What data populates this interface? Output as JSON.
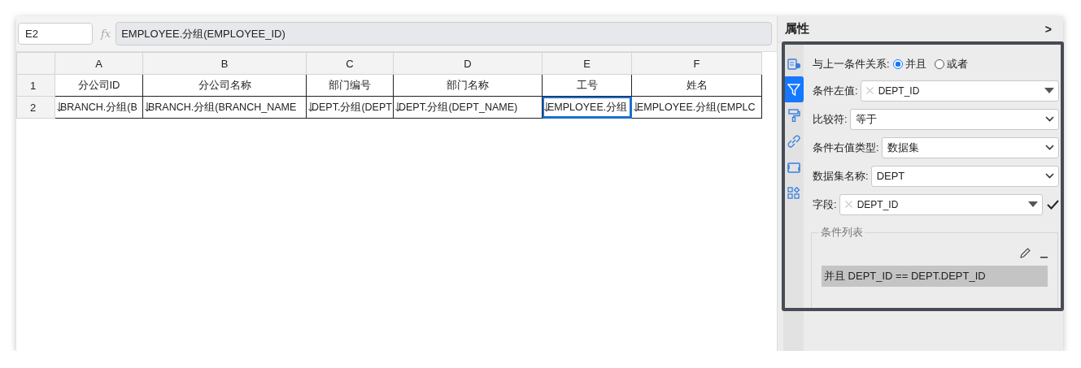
{
  "name_box": "E2",
  "function_label": "fx",
  "formula": "EMPLOYEE.分组(EMPLOYEE_ID)",
  "columns": [
    "A",
    "B",
    "C",
    "D",
    "E",
    "F"
  ],
  "rows": [
    {
      "number": "1",
      "cells": [
        {
          "text": "分公司ID",
          "kind": "header",
          "selected": false
        },
        {
          "text": "分公司名称",
          "kind": "header",
          "selected": false
        },
        {
          "text": "部门编号",
          "kind": "header",
          "selected": false
        },
        {
          "text": "部门名称",
          "kind": "header",
          "selected": false
        },
        {
          "text": "工号",
          "kind": "header",
          "selected": false
        },
        {
          "text": "姓名",
          "kind": "header",
          "selected": false
        }
      ]
    },
    {
      "number": "2",
      "cells": [
        {
          "text": "BRANCH.分组(B",
          "kind": "expand",
          "selected": false
        },
        {
          "text": "BRANCH.分组(BRANCH_NAME",
          "kind": "expand",
          "selected": false
        },
        {
          "text": "DEPT.分组(DEPT",
          "kind": "expand",
          "selected": false
        },
        {
          "text": "DEPT.分组(DEPT_NAME)",
          "kind": "expand",
          "selected": false
        },
        {
          "text": "EMPLOYEE.分组",
          "kind": "expand",
          "selected": true
        },
        {
          "text": "EMPLOYEE.分组(EMPLC",
          "kind": "expand",
          "selected": false
        }
      ]
    }
  ],
  "panel": {
    "title": "属性",
    "collapse": ">",
    "side_tabs": [
      {
        "kind": "settings",
        "selected": false
      },
      {
        "kind": "filter",
        "selected": true
      },
      {
        "kind": "brush",
        "selected": false
      },
      {
        "kind": "link",
        "selected": false
      },
      {
        "kind": "frame",
        "selected": false
      },
      {
        "kind": "widgets",
        "selected": false
      }
    ],
    "relation": {
      "label": "与上一条件关系:",
      "options": [
        {
          "label": "并且",
          "selected": true
        },
        {
          "label": "或者",
          "selected": false
        }
      ]
    },
    "fields": [
      {
        "kind": "tag",
        "label": "条件左值:",
        "value": "DEPT_ID",
        "confirm": false
      },
      {
        "kind": "select",
        "label": "比较符:",
        "value": "等于",
        "confirm": false
      },
      {
        "kind": "select",
        "label": "条件右值类型:",
        "value": "数据集",
        "confirm": false
      },
      {
        "kind": "select",
        "label": "数据集名称:",
        "value": "DEPT",
        "confirm": false
      },
      {
        "kind": "tag",
        "label": "字段:",
        "value": "DEPT_ID",
        "confirm": true
      }
    ],
    "condition_list": {
      "title": "条件列表",
      "items": [
        {
          "text": "并且 DEPT_ID == DEPT.DEPT_ID",
          "selected": true
        }
      ]
    }
  }
}
